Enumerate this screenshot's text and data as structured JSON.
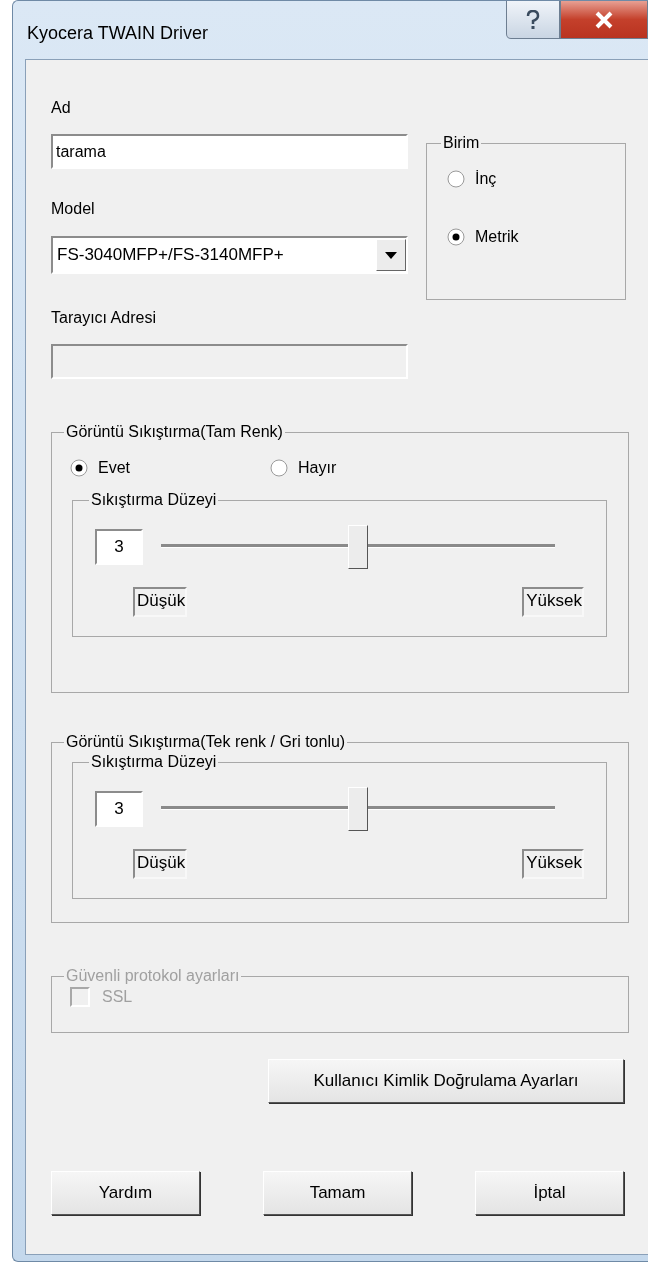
{
  "window": {
    "title": "Kyocera TWAIN Driver"
  },
  "name_field": {
    "label": "Ad",
    "value": "tarama"
  },
  "model_field": {
    "label": "Model",
    "value": "FS-3040MFP+/FS-3140MFP+"
  },
  "unit_group": {
    "title": "Birim",
    "options": [
      {
        "label": "İnç",
        "selected": false
      },
      {
        "label": "Metrik",
        "selected": true
      }
    ]
  },
  "address_field": {
    "label": "Tarayıcı Adresi",
    "disabled": true
  },
  "color_compression": {
    "title": "Görüntü Sıkıştırma(Tam Renk)",
    "options": [
      {
        "label": "Evet",
        "selected": true
      },
      {
        "label": "Hayır",
        "selected": false
      }
    ],
    "level_group": {
      "title": "Sıkıştırma Düzeyi",
      "value": "3",
      "level": 0.5,
      "low": "Düşük",
      "high": "Yüksek"
    }
  },
  "mono_compression": {
    "title": "Görüntü Sıkıştırma(Tek renk / Gri tonlu)",
    "level_group": {
      "title": "Sıkıştırma Düzeyi",
      "value": "3",
      "level": 0.5,
      "low": "Düşük",
      "high": "Yüksek"
    }
  },
  "secure_group": {
    "title": "Güvenli protokol ayarları",
    "disabled": true,
    "ssl": {
      "label": "SSL",
      "checked": false
    }
  },
  "auth_button": "Kullanıcı Kimlik Doğrulama Ayarları",
  "buttons": [
    "Yardım",
    "Tamam",
    "İptal"
  ]
}
